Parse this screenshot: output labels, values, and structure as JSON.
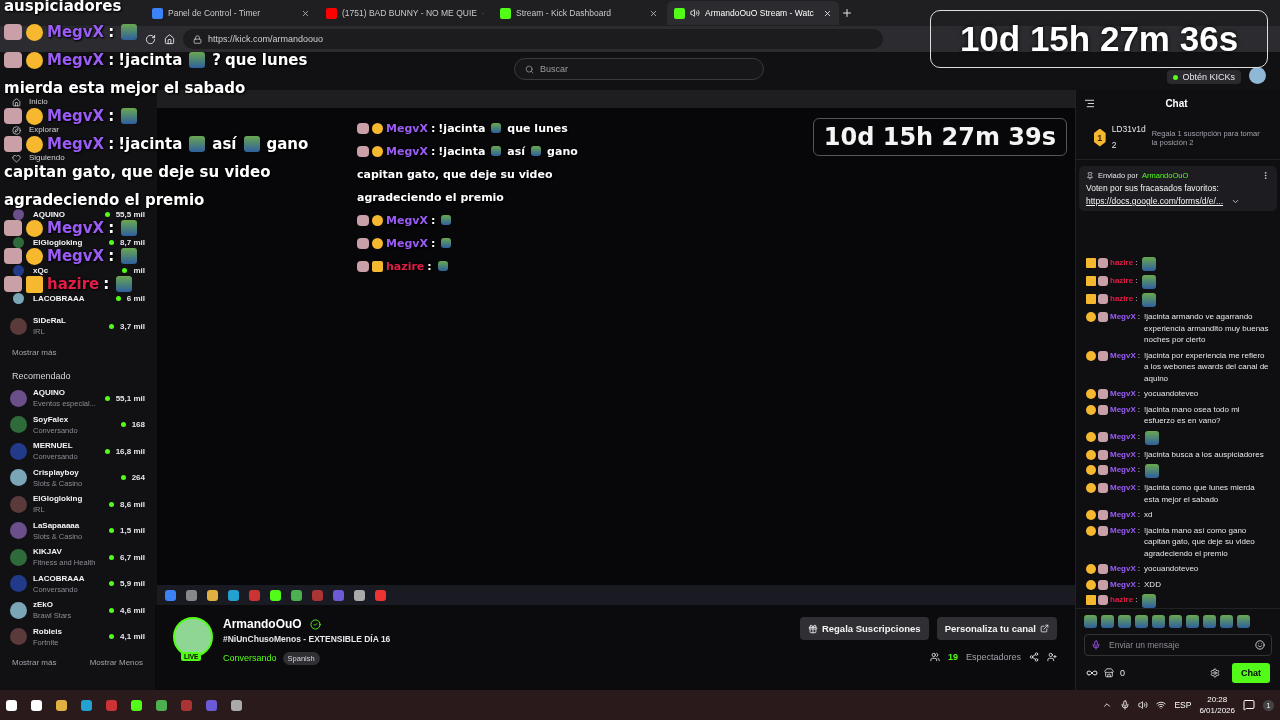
{
  "browser": {
    "tabs": [
      {
        "title": "Panel de Control - Timer",
        "kind": "timer",
        "selected": false
      },
      {
        "title": "(1751) BAD BUNNY - NO ME QUIE",
        "kind": "youtube",
        "selected": false
      },
      {
        "title": "Stream - Kick Dashboard",
        "kind": "kick",
        "selected": false
      },
      {
        "title": "ArmandoOuO Stream - Watc",
        "kind": "kick",
        "selected": true
      }
    ],
    "url": "https://kick.com/armandoouo"
  },
  "timer": "10d 15h 27m 36s",
  "overlay_chat": [
    {
      "kind": "text",
      "text": "auspiciadores"
    },
    {
      "kind": "message",
      "badge": {
        "kind": "sub"
      },
      "user": "MegvX",
      "sep": ":",
      "color": "#9b5cf6",
      "segments": [
        {
          "kind": "emote"
        }
      ]
    },
    {
      "kind": "message",
      "badge": {
        "kind": "sub"
      },
      "user": "MegvX",
      "sep": ":",
      "color": "#9b5cf6",
      "segments": [
        {
          "kind": "text",
          "text": "!jacinta"
        },
        {
          "kind": "emote"
        },
        {
          "kind": "text",
          "text": "?"
        },
        {
          "kind": "text",
          "text": "que lunes"
        }
      ]
    },
    {
      "kind": "text",
      "text": "mierda esta mejor el sabado"
    },
    {
      "kind": "message",
      "badge": {
        "kind": "sub"
      },
      "user": "MegvX",
      "sep": ":",
      "color": "#9b5cf6",
      "segments": [
        {
          "kind": "emote"
        }
      ]
    },
    {
      "kind": "message",
      "badge": {
        "kind": "sub"
      },
      "user": "MegvX",
      "sep": ":",
      "color": "#9b5cf6",
      "segments": [
        {
          "kind": "text",
          "text": "!jacinta"
        },
        {
          "kind": "emote"
        },
        {
          "kind": "text",
          "text": "así"
        },
        {
          "kind": "emote"
        },
        {
          "kind": "text",
          "text": "gano"
        }
      ]
    },
    {
      "kind": "text",
      "text": "capitan gato, que deje su video"
    },
    {
      "kind": "text",
      "text": "agradeciendo el premio"
    },
    {
      "kind": "message",
      "badge": {
        "kind": "sub"
      },
      "user": "MegvX",
      "sep": ":",
      "color": "#9b5cf6",
      "segments": [
        {
          "kind": "emote"
        }
      ]
    },
    {
      "kind": "message",
      "badge": {
        "kind": "sub"
      },
      "user": "MegvX",
      "sep": ":",
      "color": "#9b5cf6",
      "segments": [
        {
          "kind": "emote"
        }
      ]
    },
    {
      "kind": "message",
      "badge": {
        "kind": "crown"
      },
      "user": "hazire",
      "sep": ":",
      "color": "#e11d48",
      "segments": [
        {
          "kind": "emote"
        }
      ]
    }
  ],
  "kick": {
    "search": {
      "placeholder": "Buscar"
    },
    "get_kicks": "Obtén KICKs",
    "nav": [
      {
        "label": "Inicio",
        "kind": "home"
      },
      {
        "label": "Explorar",
        "kind": "explore"
      },
      {
        "label": "Siguiendo",
        "kind": "following"
      }
    ],
    "following": [
      {
        "name": "AQUINO",
        "viewers": "55,5 mil"
      },
      {
        "name": "ElGlogloking",
        "viewers": "8,7 mil"
      },
      {
        "name": "xQc",
        "viewers": "mil"
      },
      {
        "name": "LACOBRAAA",
        "viewers": "6 mil"
      },
      {
        "name": "SiDeRaL",
        "category": "IRL",
        "viewers": "3,7 mil"
      }
    ],
    "following_more": "Mostrar más",
    "recommended_heading": "Recomendado",
    "recommended": [
      {
        "name": "AQUINO",
        "category": "Eventos especial...",
        "viewers": "55,1 mil"
      },
      {
        "name": "SoyFalex",
        "category": "Conversando",
        "viewers": "168"
      },
      {
        "name": "MERNUEL",
        "category": "Conversando",
        "viewers": "16,8 mil"
      },
      {
        "name": "Crisplayboy",
        "category": "Slots & Casino",
        "viewers": "264"
      },
      {
        "name": "ElGlogloking",
        "category": "IRL",
        "viewers": "8,6 mil"
      },
      {
        "name": "LaSapaaaaa",
        "category": "Slots & Casino",
        "viewers": "1,5 mil"
      },
      {
        "name": "KIKJAV",
        "category": "Fitness and Health",
        "viewers": "6,7 mil"
      },
      {
        "name": "LACOBRAAA",
        "category": "Conversando",
        "viewers": "5,9 mil"
      },
      {
        "name": "zEkO",
        "category": "Brawl Stars",
        "viewers": "4,6 mil"
      },
      {
        "name": "Robleis",
        "category": "Fortnite",
        "viewers": "4,1 mil"
      }
    ],
    "show_more": "Mostrar más",
    "show_less": "Mostrar Menos"
  },
  "video": {
    "timer": "10d 15h 27m 39s",
    "chat": [
      {
        "kind": "message",
        "badge": {
          "kind": "sub"
        },
        "user": "MegvX",
        "sep": ":",
        "color": "#9b5cf6",
        "segments": [
          {
            "kind": "text",
            "text": "!jacinta"
          },
          {
            "kind": "emote"
          },
          {
            "kind": "text",
            "text": "que lunes"
          }
        ]
      },
      {
        "kind": "message",
        "badge": {
          "kind": "sub"
        },
        "user": "MegvX",
        "sep": ":",
        "color": "#9b5cf6",
        "segments": [
          {
            "kind": "text",
            "text": "!jacinta"
          },
          {
            "kind": "emote"
          },
          {
            "kind": "text",
            "text": "así"
          },
          {
            "kind": "emote"
          },
          {
            "kind": "text",
            "text": "gano"
          }
        ]
      },
      {
        "kind": "text",
        "text": "capitan gato, que deje su video"
      },
      {
        "kind": "text",
        "text": "agradeciendo el premio"
      },
      {
        "kind": "message",
        "badge": {
          "kind": "sub"
        },
        "user": "MegvX",
        "sep": ":",
        "color": "#9b5cf6",
        "segments": [
          {
            "kind": "emote"
          }
        ]
      },
      {
        "kind": "message",
        "badge": {
          "kind": "sub"
        },
        "user": "MegvX",
        "sep": ":",
        "color": "#9b5cf6",
        "segments": [
          {
            "kind": "emote"
          }
        ]
      },
      {
        "kind": "message",
        "badge": {
          "kind": "crown"
        },
        "user": "hazire",
        "sep": ":",
        "color": "#e11d48",
        "segments": [
          {
            "kind": "emote"
          }
        ]
      }
    ]
  },
  "stream": {
    "channel": "ArmandoOuO",
    "live": "LIVE",
    "title": "#NiUnChusoMenos - EXTENSIBLE DÍA 16",
    "category": "Conversando",
    "tag": "Spanish",
    "gift_button": "Regala Suscripciones",
    "customize_button": "Personaliza tu canal",
    "viewer_count": "19",
    "viewers_label": "Espectadores"
  },
  "chat": {
    "title": "Chat",
    "leader": {
      "rank": "1",
      "name": "LD31v1d",
      "count": "2"
    },
    "leader_hint": "Regala 1 suscripción para tomar la posición 2",
    "pinned": {
      "sent_by": "Enviado por",
      "author": "ArmandoOuO",
      "text": "Voten por sus fracasados favoritos:",
      "link": "https://docs.google.com/forms/d/e/..."
    },
    "messages": [
      {
        "badge": {
          "kind": "crown"
        },
        "user": "hazire",
        "sep": ":",
        "color": "#e11d48",
        "segments": [
          {
            "kind": "emote"
          }
        ]
      },
      {
        "badge": {
          "kind": "crown"
        },
        "user": "hazire",
        "sep": ":",
        "color": "#e11d48",
        "segments": [
          {
            "kind": "emote"
          }
        ]
      },
      {
        "badge": {
          "kind": "crown"
        },
        "user": "hazire",
        "sep": ":",
        "color": "#e11d48",
        "segments": [
          {
            "kind": "emote"
          }
        ]
      },
      {
        "badge": {
          "kind": "sub"
        },
        "user": "MegvX",
        "sep": ":",
        "color": "#9b5cf6",
        "segments": [
          {
            "kind": "text",
            "text": "!jacinta armando ve agarrando experiencia armandito muy buenas noches por cierto"
          }
        ]
      },
      {
        "badge": {
          "kind": "sub"
        },
        "user": "MegvX",
        "sep": ":",
        "color": "#9b5cf6",
        "segments": [
          {
            "kind": "text",
            "text": "!jacinta por experiencia me refiero a los webones awards del canal de aquino"
          }
        ]
      },
      {
        "badge": {
          "kind": "sub"
        },
        "user": "MegvX",
        "sep": ":",
        "color": "#9b5cf6",
        "segments": [
          {
            "kind": "text",
            "text": "yocuandoteveo"
          }
        ]
      },
      {
        "badge": {
          "kind": "sub"
        },
        "user": "MegvX",
        "sep": ":",
        "color": "#9b5cf6",
        "segments": [
          {
            "kind": "text",
            "text": "!jacinta mano osea todo mi esfuerzo es en vano?"
          }
        ]
      },
      {
        "badge": {
          "kind": "sub"
        },
        "user": "MegvX",
        "sep": ":",
        "color": "#9b5cf6",
        "segments": [
          {
            "kind": "emote"
          }
        ]
      },
      {
        "badge": {
          "kind": "sub"
        },
        "user": "MegvX",
        "sep": ":",
        "color": "#9b5cf6",
        "segments": [
          {
            "kind": "text",
            "text": "!jacinta busca a los auspiciadores"
          }
        ]
      },
      {
        "badge": {
          "kind": "sub"
        },
        "user": "MegvX",
        "sep": ":",
        "color": "#9b5cf6",
        "segments": [
          {
            "kind": "emote"
          }
        ]
      },
      {
        "badge": {
          "kind": "sub"
        },
        "user": "MegvX",
        "sep": ":",
        "color": "#9b5cf6",
        "segments": [
          {
            "kind": "text",
            "text": "!jacinta como que lunes mierda esta mejor el sabado"
          }
        ]
      },
      {
        "badge": {
          "kind": "sub"
        },
        "user": "MegvX",
        "sep": ":",
        "color": "#9b5cf6",
        "segments": [
          {
            "kind": "text",
            "text": "xd"
          }
        ]
      },
      {
        "badge": {
          "kind": "sub"
        },
        "user": "MegvX",
        "sep": ":",
        "color": "#9b5cf6",
        "segments": [
          {
            "kind": "text",
            "text": "!jacinta mano así como gano capitan gato, que deje su video agradeciendo el premio"
          }
        ]
      },
      {
        "badge": {
          "kind": "sub"
        },
        "user": "MegvX",
        "sep": ":",
        "color": "#9b5cf6",
        "segments": [
          {
            "kind": "text",
            "text": "yocuandoteveo"
          }
        ]
      },
      {
        "badge": {
          "kind": "sub"
        },
        "user": "MegvX",
        "sep": ":",
        "color": "#9b5cf6",
        "segments": [
          {
            "kind": "text",
            "text": "XDD"
          }
        ]
      },
      {
        "badge": {
          "kind": "crown"
        },
        "user": "hazire",
        "sep": ":",
        "color": "#e11d48",
        "segments": [
          {
            "kind": "emote"
          }
        ]
      }
    ],
    "input": {
      "placeholder": "Enviar un mensaje"
    },
    "kicks": "0",
    "send_button": "Chat"
  },
  "taskbar": {
    "language": "ESP",
    "time": "20:28",
    "date": "6/01/2026",
    "notifications": "1"
  }
}
